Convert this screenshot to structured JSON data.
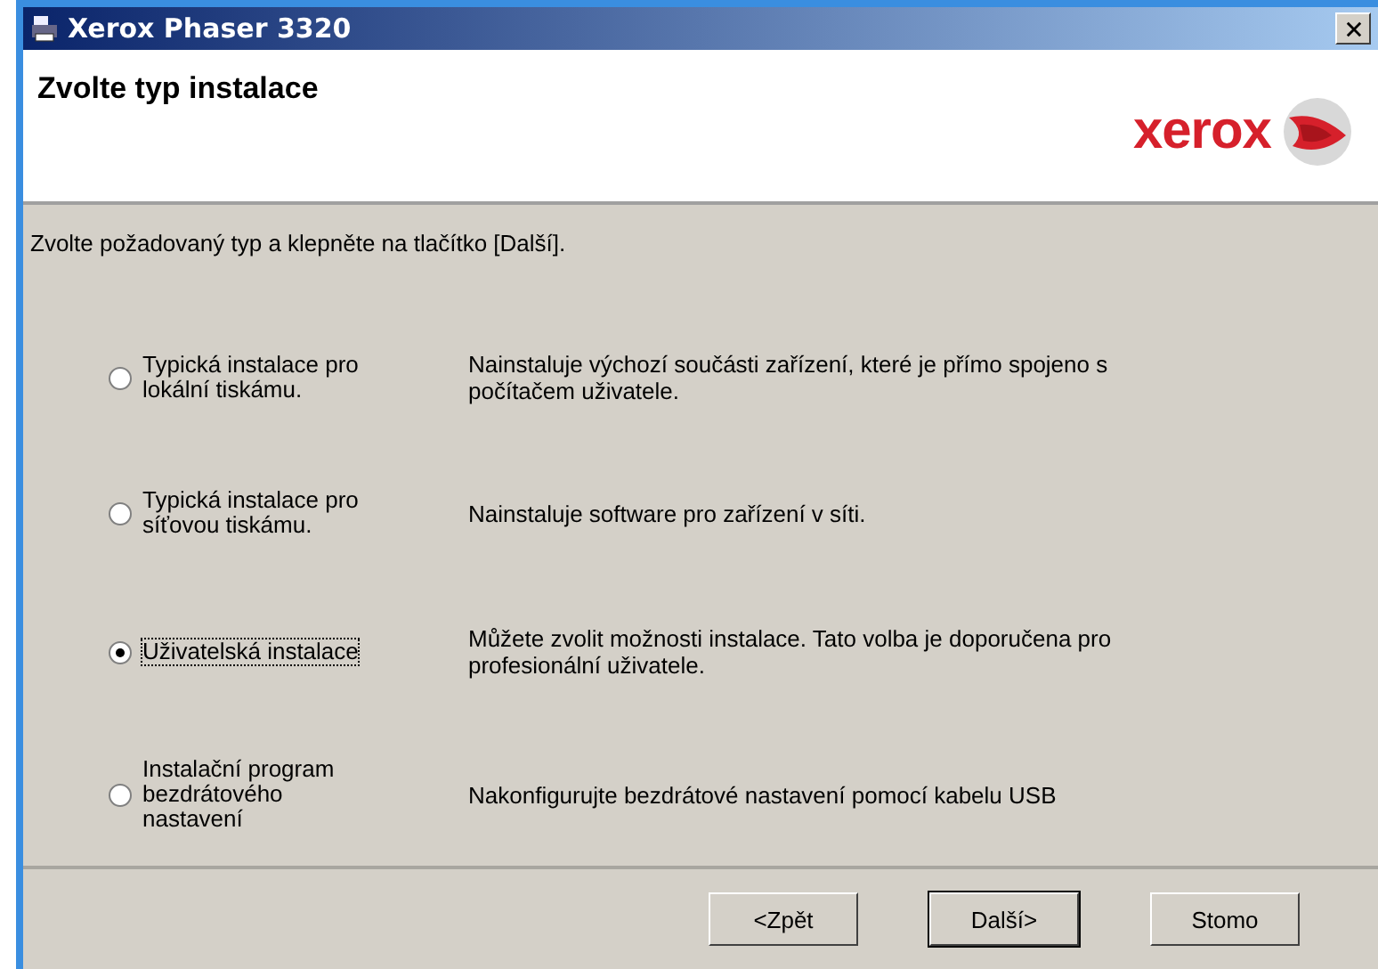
{
  "window": {
    "title": "Xerox Phaser 3320"
  },
  "header": {
    "title": "Zvolte typ instalace",
    "logo_text": "xerox"
  },
  "instruction": "Zvolte požadovaný typ a klepněte na tlačítko [Další].",
  "options": [
    {
      "label": "Typická instalace pro\nlokální tiskámu.",
      "description": "Nainstaluje výchozí součásti zařízení, které je přímo spojeno s\npočítačem uživatele.",
      "selected": false
    },
    {
      "label": "Typická instalace pro\nsíťovou tiskámu.",
      "description": "Nainstaluje software pro zařízení v síti.",
      "selected": false
    },
    {
      "label": "Uživatelská instalace",
      "description": "Můžete zvolit možnosti instalace. Tato volba je doporučena pro\nprofesionální uživatele.",
      "selected": true
    },
    {
      "label": "Instalační program\nbezdrátového\nnastavení",
      "description": "Nakonfigurujte bezdrátové nastavení pomocí kabelu USB",
      "selected": false
    }
  ],
  "buttons": [
    {
      "label": "<Zpět",
      "default": false
    },
    {
      "label": "Další>",
      "default": true
    },
    {
      "label": "Stomo",
      "default": false
    }
  ]
}
